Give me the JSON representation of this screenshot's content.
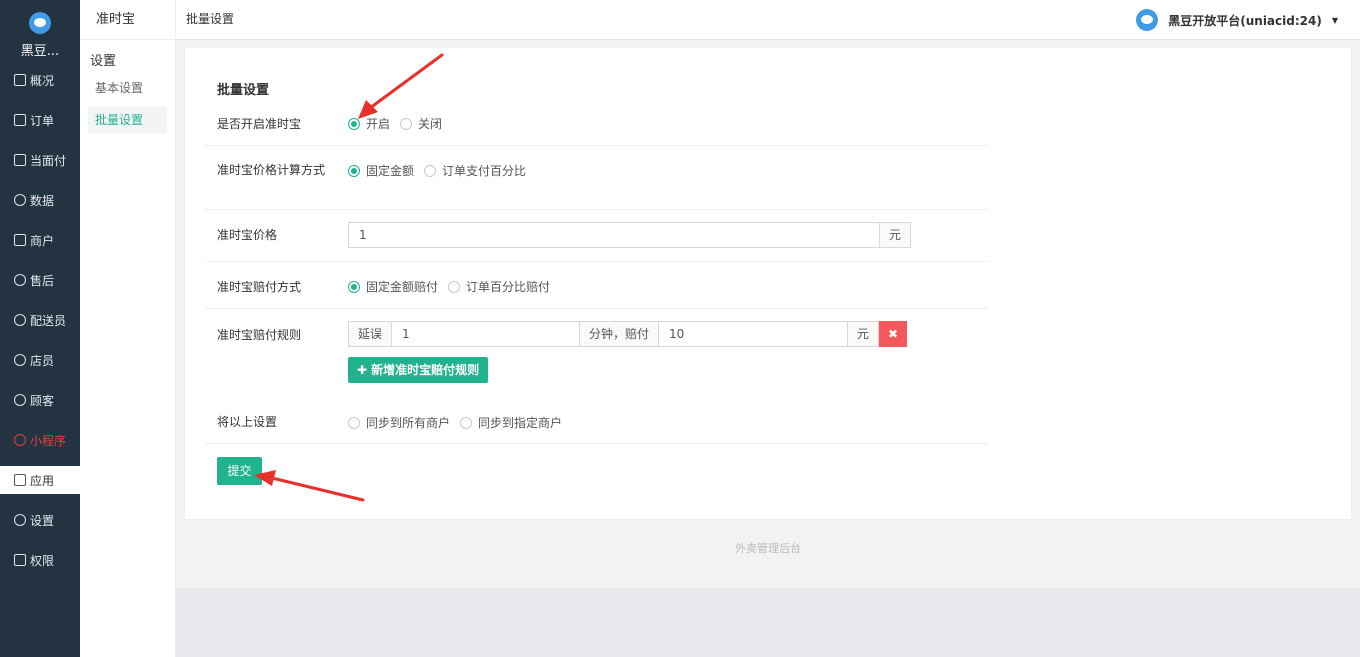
{
  "app": {
    "logo_text": "黑豆..."
  },
  "sidebar": {
    "items": [
      {
        "label": "概况",
        "icon": "grid-icon"
      },
      {
        "label": "订单",
        "icon": "list-icon"
      },
      {
        "label": "当面付",
        "icon": "list-icon"
      },
      {
        "label": "数据",
        "icon": "chart-icon"
      },
      {
        "label": "商户",
        "icon": "store-icon"
      },
      {
        "label": "售后",
        "icon": "support-icon"
      },
      {
        "label": "配送员",
        "icon": "user-icon"
      },
      {
        "label": "店员",
        "icon": "user-icon"
      },
      {
        "label": "顾客",
        "icon": "user-icon"
      },
      {
        "label": "小程序",
        "icon": "miniapp-icon"
      },
      {
        "label": "应用",
        "icon": "apps-icon"
      },
      {
        "label": "设置",
        "icon": "gear-icon"
      },
      {
        "label": "权限",
        "icon": "lock-icon"
      }
    ]
  },
  "subsidebar": {
    "title": "准时宝",
    "group": "设置",
    "items": [
      "基本设置",
      "批量设置"
    ]
  },
  "topbar": {
    "breadcrumb": "批量设置",
    "user": "黑豆开放平台(uniacid:24)"
  },
  "form": {
    "title": "批量设置",
    "enable": {
      "label": "是否开启准时宝",
      "on": "开启",
      "off": "关闭"
    },
    "price_mode": {
      "label": "准时宝价格计算方式",
      "opt1": "固定金额",
      "opt2": "订单支付百分比"
    },
    "price": {
      "label": "准时宝价格",
      "value": "1",
      "unit": "元"
    },
    "comp_mode": {
      "label": "准时宝赔付方式",
      "opt1": "固定金额赔付",
      "opt2": "订单百分比赔付"
    },
    "rule": {
      "label": "准时宝赔付规则",
      "prefix": "延误",
      "minutes": "1",
      "mid": "分钟，赔付",
      "amount": "10",
      "unit": "元",
      "add_label": "新增准时宝赔付规则"
    },
    "sync": {
      "label": "将以上设置",
      "opt1": "同步到所有商户",
      "opt2": "同步到指定商户"
    },
    "submit": "提交"
  },
  "footer": "外卖管理后台",
  "colors": {
    "accent": "#21b38d",
    "danger": "#f4585a",
    "sidebar": "#243342",
    "arrow": "#e8302a"
  }
}
